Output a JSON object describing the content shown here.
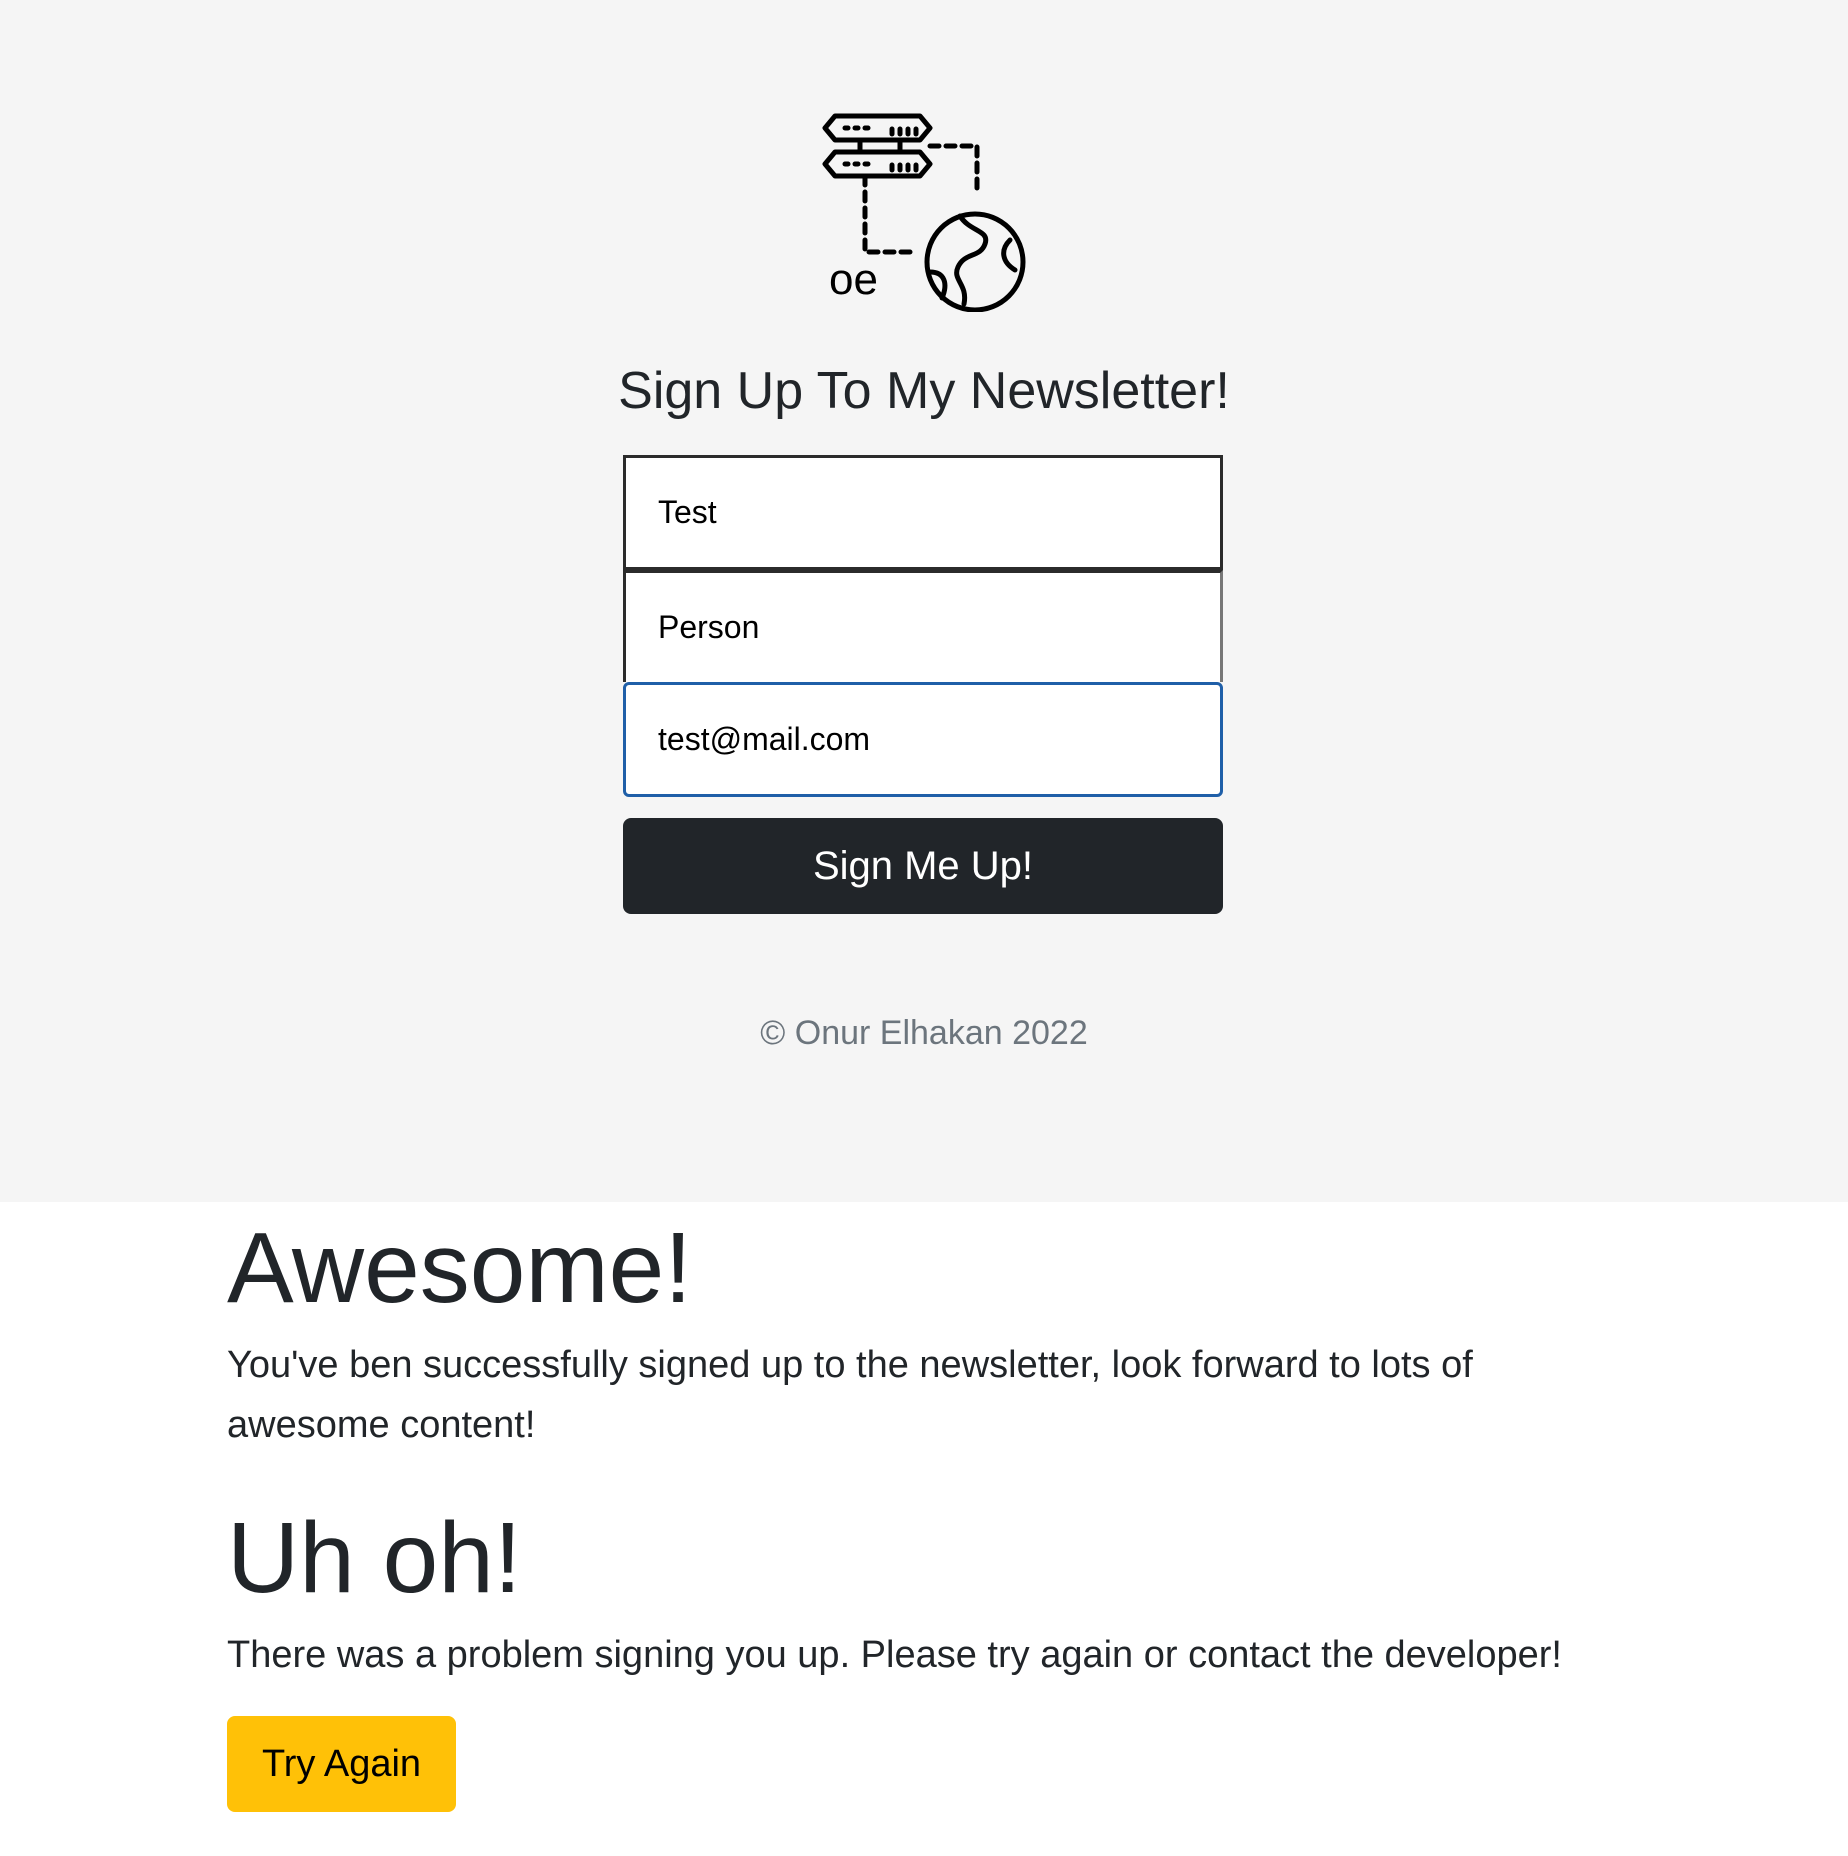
{
  "signup": {
    "logo_text": "oe",
    "title": "Sign Up To My Newsletter!",
    "first_name_value": "Test",
    "last_name_value": "Person",
    "email_value": "test@mail.com",
    "submit_label": "Sign Me Up!",
    "footer_text": "© Onur Elhakan 2022"
  },
  "success": {
    "heading": "Awesome!",
    "message": "You've ben successfully signed up to the newsletter, look forward to lots of awesome content!"
  },
  "failure": {
    "heading": "Uh oh!",
    "message": "There was a problem signing you up. Please try again or contact the developer!",
    "button_label": "Try Again"
  },
  "colors": {
    "page_background": "#f5f5f5",
    "dark_button": "#212529",
    "warning_button": "#ffc107",
    "focus_border": "#1f5fa8",
    "muted_text": "#6c757d"
  },
  "icons": {
    "logo": "server-network-globe-icon"
  }
}
